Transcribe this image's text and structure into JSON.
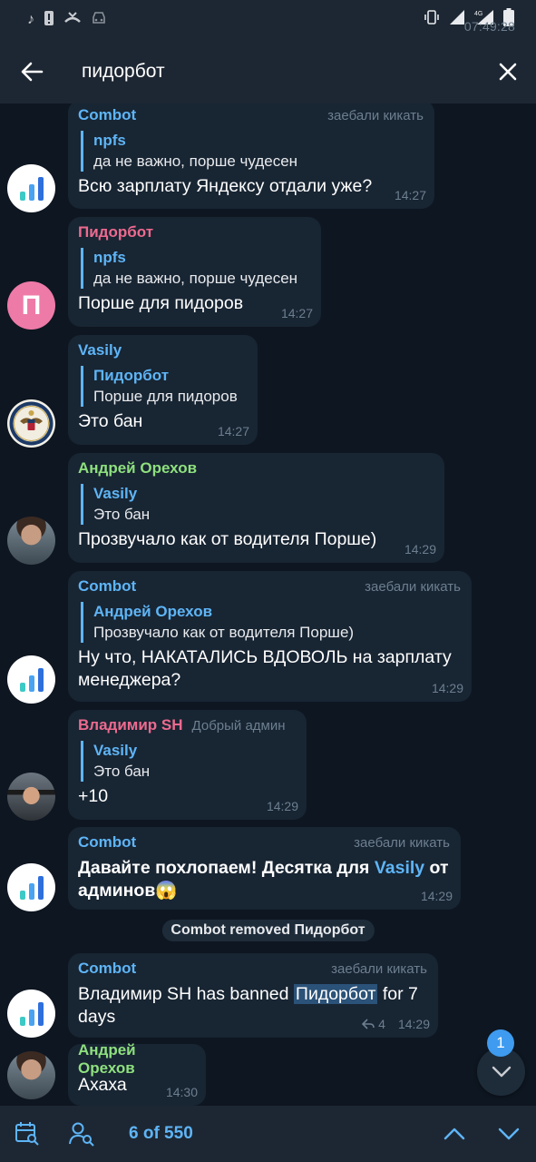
{
  "status_bar": {
    "time": "07:49:28"
  },
  "header": {
    "search_query": "пидорбот"
  },
  "messages": [
    {
      "sender": "Combot",
      "title": "заебали кикать",
      "reply_name": "npfs",
      "reply_text": "да не важно, порше чудесен",
      "text": "Всю зарплату Яндексу отдали уже?",
      "time": "14:27"
    },
    {
      "sender": "Пидорбот",
      "reply_name": "npfs",
      "reply_text": "да не важно, порше чудесен",
      "text": "Порше для пидоров",
      "time": "14:27",
      "avatar_letter": "П"
    },
    {
      "sender": "Vasily",
      "reply_name": "Пидорбот",
      "reply_text": "Порше для пидоров",
      "text": "Это бан",
      "time": "14:27"
    },
    {
      "sender": "Андрей Орехов",
      "reply_name": "Vasily",
      "reply_text": "Это бан",
      "text": "Прозвучало как от водителя Порше)",
      "time": "14:29"
    },
    {
      "sender": "Combot",
      "title": "заебали кикать",
      "reply_name": "Андрей Орехов",
      "reply_text": "Прозвучало как от водителя Порше)",
      "text_line1": "Ну что, НАКАТАЛИСЬ ВДОВОЛЬ на зарплату",
      "text_line2": "менеджера?",
      "time": "14:29"
    },
    {
      "sender": "Владимир SH",
      "title": "Добрый админ",
      "reply_name": "Vasily",
      "reply_text": "Это бан",
      "text": "+10",
      "time": "14:29"
    },
    {
      "sender": "Combot",
      "title": "заебали кикать",
      "text_a": "Давайте похлопаем! Десятка для ",
      "text_mention": "Vasily",
      "text_b": " от",
      "text_line2": "админов😱",
      "time": "14:29"
    },
    {
      "sender": "Combot",
      "title": "заебали кикать",
      "text_a": "Владимир SH has banned ",
      "text_highlight": "Пидорбот",
      "text_b": " for 7",
      "text_line2": "days",
      "reply_count": "4",
      "time": "14:29"
    },
    {
      "sender": "Андрей Орехов",
      "text": "Ахаха",
      "time": "14:30"
    }
  ],
  "service_message": "Combot removed Пидорбот",
  "unread_badge": "1",
  "bottom": {
    "counter": "6 of 550"
  },
  "colors": {
    "combot": "#5eb5f7",
    "pidorbot": "#ee6a8f",
    "andrey": "#8ee07e",
    "vladimir": "#ee6a8f",
    "accent": "#5eb5f7"
  }
}
